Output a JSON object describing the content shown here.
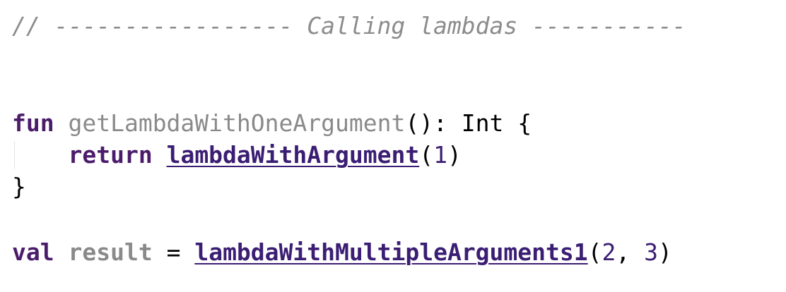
{
  "code": {
    "line1": {
      "comment": "// ----------------- Calling lambdas -----------"
    },
    "line2": {
      "keyword": "fun",
      "function_name": "getLambdaWithOneArgument",
      "params": "():",
      "return_type": "Int",
      "open_brace": "{"
    },
    "line3": {
      "indent": "    ",
      "keyword": "return",
      "call_name": "lambdaWithArgument",
      "paren_open": "(",
      "arg": "1",
      "paren_close": ")"
    },
    "line4": {
      "close_brace": "}"
    },
    "line5": {
      "keyword": "val",
      "variable_name": "result",
      "equals": "=",
      "call_name": "lambdaWithMultipleArguments1",
      "paren_open": "(",
      "arg1": "2",
      "comma": ", ",
      "arg2": "3",
      "paren_close": ")"
    }
  },
  "colors": {
    "keyword": "#4b1c6b",
    "comment": "#8c8c8c",
    "call": "#3b1e73",
    "unused": "#8a8a8a"
  }
}
